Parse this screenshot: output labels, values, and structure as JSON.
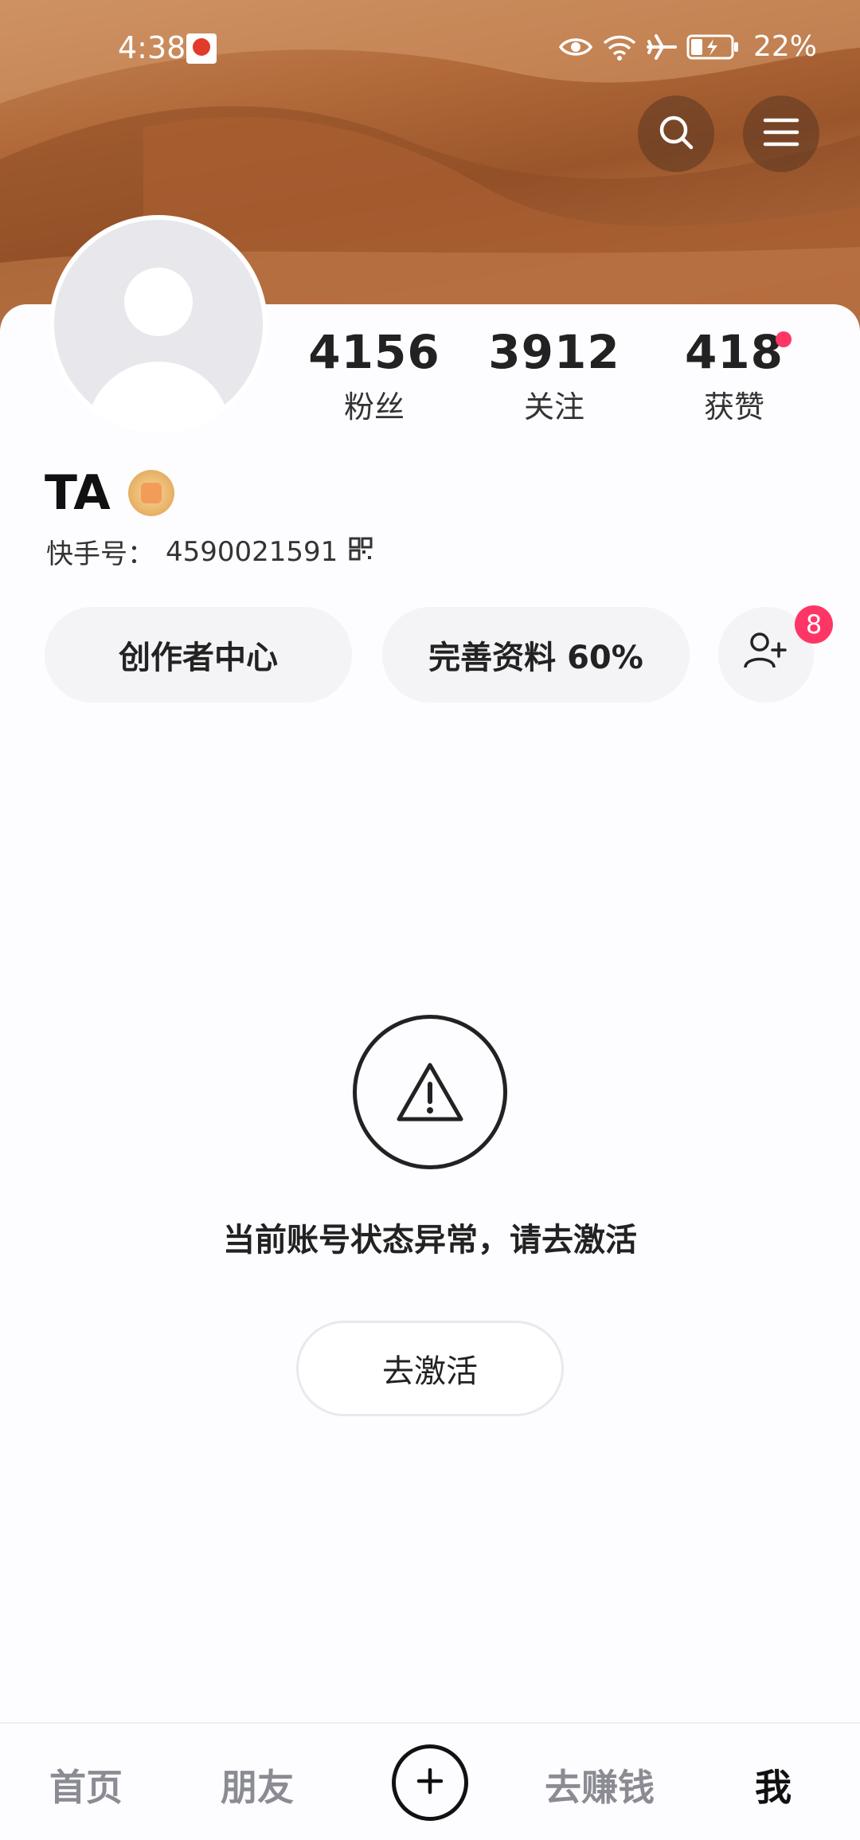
{
  "status_bar": {
    "time": "4:38",
    "battery": "22%",
    "icons": [
      "eye-icon",
      "wifi-icon",
      "airplane-icon",
      "battery-charging-icon"
    ]
  },
  "header": {
    "search_icon": "search-icon",
    "menu_icon": "menu-icon"
  },
  "profile": {
    "name": "TA",
    "kuaishou_id_label": "快手号：",
    "kuaishou_id": "4590021591",
    "stats": [
      {
        "value": "4156",
        "label": "粉丝"
      },
      {
        "value": "3912",
        "label": "关注"
      },
      {
        "value": "418",
        "label": "获赞"
      }
    ]
  },
  "actions": {
    "creator_center": "创作者中心",
    "complete_profile": "完善资料 60%",
    "add_friend_badge": "8"
  },
  "notice": {
    "message": "当前账号状态异常，请去激活",
    "activate_button": "去激活"
  },
  "bottom_nav": {
    "home": "首页",
    "friends": "朋友",
    "earn": "去赚钱",
    "me": "我"
  },
  "colors": {
    "accent_red": "#fe3666",
    "cover_brown": "#b26a3a",
    "pill_bg": "#f4f3f6"
  }
}
